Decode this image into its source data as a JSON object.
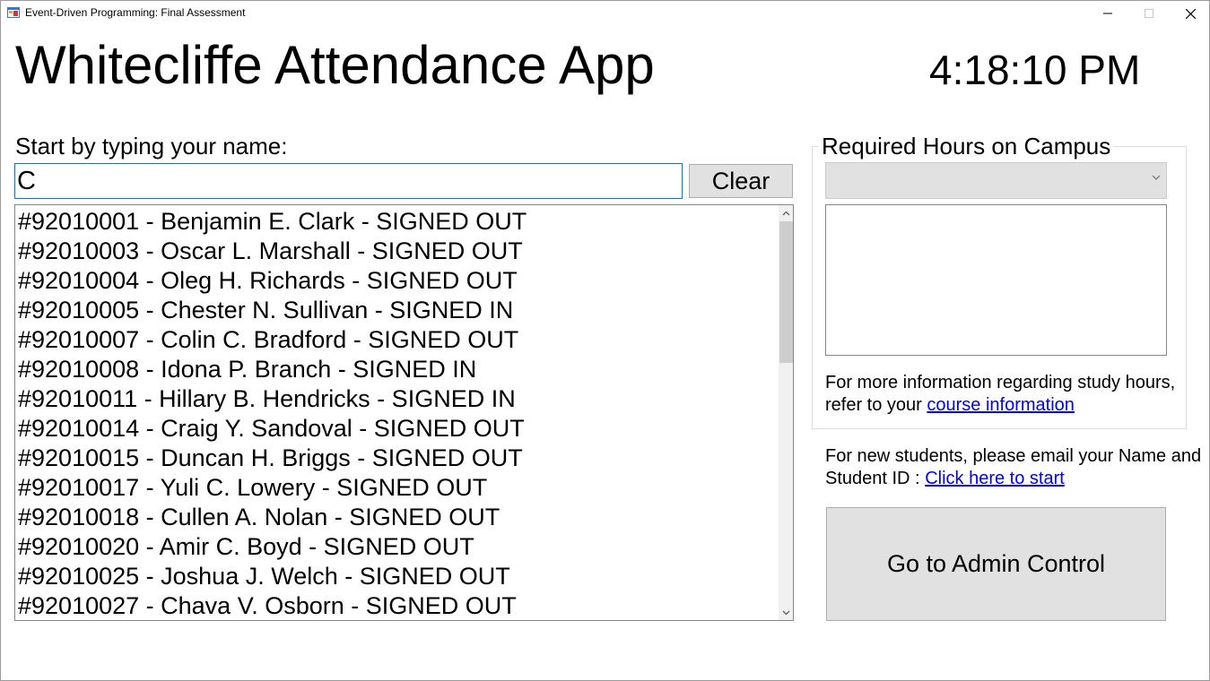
{
  "window": {
    "title": "Event-Driven Programming: Final Assessment",
    "app_icon": "winforms-app-icon",
    "controls": [
      "minimize-icon",
      "maximize-icon",
      "close-icon"
    ]
  },
  "header": {
    "app_title": "Whitecliffe Attendance App",
    "clock": "4:18:10 PM"
  },
  "search": {
    "prompt": "Start by typing your name:",
    "value": "C",
    "clear_label": "Clear"
  },
  "students": [
    "#92010001 - Benjamin E. Clark - SIGNED OUT",
    "#92010003 - Oscar L. Marshall - SIGNED OUT",
    "#92010004 - Oleg H. Richards - SIGNED OUT",
    "#92010005 - Chester N. Sullivan - SIGNED IN",
    "#92010007 - Colin C. Bradford - SIGNED OUT",
    "#92010008 - Idona P. Branch - SIGNED IN",
    "#92010011 - Hillary B. Hendricks - SIGNED IN",
    "#92010014 - Craig Y. Sandoval - SIGNED OUT",
    "#92010015 - Duncan H. Briggs - SIGNED OUT",
    "#92010017 - Yuli C. Lowery - SIGNED OUT",
    "#92010018 - Cullen A. Nolan - SIGNED OUT",
    "#92010020 - Amir C. Boyd - SIGNED OUT",
    "#92010025 - Joshua J. Welch - SIGNED OUT",
    "#92010027 - Chava V. Osborn - SIGNED OUT"
  ],
  "hours": {
    "group_label": "Required Hours on Campus",
    "selected": "",
    "info_text": "For more information regarding study hours, refer to your",
    "info_link": "course information"
  },
  "new_students": {
    "text": "For new students, please email your Name and Student ID :",
    "link": "Click here to start"
  },
  "admin": {
    "button_label": "Go to Admin Control"
  },
  "colors": {
    "accent_border": "#0078d7",
    "button_bg": "#e1e1e1",
    "link": "#0000ee"
  }
}
